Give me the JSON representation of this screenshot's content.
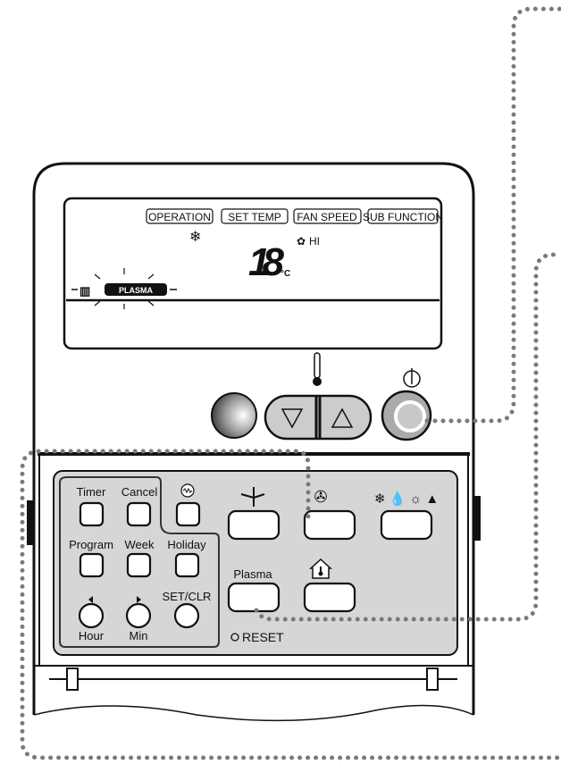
{
  "lcd": {
    "mode_labels": [
      "OPERATION",
      "SET TEMP",
      "FAN SPEED",
      "SUB FUNCTION"
    ],
    "mode_icon": "snowflake-icon",
    "temperature": "18",
    "unit": "°C",
    "fan_speed": "HI",
    "plasma_indicator": "PLASMA"
  },
  "front": {
    "temp_down_icon": "triangle-down-icon",
    "temp_up_icon": "triangle-up-icon",
    "power_icon": "power-icon"
  },
  "panel": {
    "timer": "Timer",
    "cancel": "Cancel",
    "program": "Program",
    "week": "Week",
    "holiday": "Holiday",
    "hour": "Hour",
    "min": "Min",
    "set_clr": "SET/CLR",
    "plasma": "Plasma",
    "reset": "RESET"
  },
  "colors": {
    "panel": "#d6d6d6",
    "dots": "#7a7a7a",
    "power_inner": "#c8c8c8"
  }
}
